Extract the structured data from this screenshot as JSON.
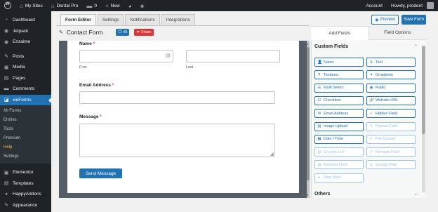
{
  "adminbar": {
    "my_sites": "My Sites",
    "site_name": "Dental Pro",
    "comments_count": "0",
    "new_label": "New",
    "account": "Account",
    "howdy": "Howdy, prodent"
  },
  "sidebar": {
    "items_top": [
      {
        "label": "Dashboard",
        "icon": "dashboard-icon",
        "glyph": "◔"
      },
      {
        "label": "Jetpack",
        "icon": "jetpack-icon",
        "glyph": "◉"
      },
      {
        "label": "Enzaime",
        "icon": "enzaime-icon",
        "glyph": "◉"
      }
    ],
    "items_mid": [
      {
        "label": "Posts",
        "icon": "pin-icon",
        "glyph": "✎"
      },
      {
        "label": "Media",
        "icon": "media-icon",
        "glyph": "▣"
      },
      {
        "label": "Pages",
        "icon": "pages-icon",
        "glyph": "▤"
      },
      {
        "label": "Comments",
        "icon": "comments-icon",
        "glyph": "▬"
      }
    ],
    "active": {
      "label": "weForms",
      "icon": "weforms-icon",
      "glyph": "◪"
    },
    "submenu": [
      "All Forms",
      "Entries",
      "Tools",
      "Premium",
      "Help",
      "Settings"
    ],
    "submenu_current": "Help",
    "items_bottom": [
      {
        "label": "Elementor",
        "icon": "elementor-icon",
        "glyph": "▣"
      },
      {
        "label": "Templates",
        "icon": "templates-icon",
        "glyph": "▤"
      },
      {
        "label": "HappyAddons",
        "icon": "happyaddons-icon",
        "glyph": "◕"
      },
      {
        "label": "Appearance",
        "icon": "appearance-icon",
        "glyph": "✎"
      }
    ]
  },
  "tabs": [
    "Form Editor",
    "Settings",
    "Notifications",
    "Integrations"
  ],
  "active_tab": "Form Editor",
  "actions": {
    "preview": "Preview",
    "save": "Save Form"
  },
  "form": {
    "title": "Contact Form",
    "id_badge": "#5",
    "share_badge": "Share",
    "name_label": "Name",
    "first_label": "First",
    "last_label": "Last",
    "email_label": "Email Address",
    "message_label": "Message",
    "required_mark": "*",
    "submit_label": "Send Message"
  },
  "panel": {
    "tabs": [
      "Add Fields",
      "Field Options"
    ],
    "active_tab": "Add Fields",
    "custom_fields_title": "Custom Fields",
    "others_title": "Others",
    "fields": [
      {
        "label": "Name",
        "icon": "user-icon",
        "glyph": "👤",
        "enabled": true
      },
      {
        "label": "Text",
        "icon": "text-icon",
        "glyph": "A",
        "enabled": true
      },
      {
        "label": "Textarea",
        "icon": "paragraph-icon",
        "glyph": "¶",
        "enabled": true
      },
      {
        "label": "Dropdown",
        "icon": "dropdown-icon",
        "glyph": "▾",
        "enabled": true
      },
      {
        "label": "Multi Select",
        "icon": "list-icon",
        "glyph": "☰",
        "enabled": true
      },
      {
        "label": "Radio",
        "icon": "radio-icon",
        "glyph": "◉",
        "enabled": true
      },
      {
        "label": "Checkbox",
        "icon": "checkbox-icon",
        "glyph": "☑",
        "enabled": true
      },
      {
        "label": "Website URL",
        "icon": "link-icon",
        "glyph": "🔗",
        "enabled": true
      },
      {
        "label": "Email Address",
        "icon": "envelope-icon",
        "glyph": "✉",
        "enabled": true
      },
      {
        "label": "Hidden Field",
        "icon": "eye-slash-icon",
        "glyph": "◐",
        "enabled": true
      },
      {
        "label": "Image Upload",
        "icon": "image-icon",
        "glyph": "▨",
        "enabled": true
      },
      {
        "label": "Repeat Field",
        "icon": "repeat-icon",
        "glyph": "↻",
        "enabled": false
      },
      {
        "label": "Date / Time",
        "icon": "calendar-icon",
        "glyph": "▦",
        "enabled": true
      },
      {
        "label": "File Upload",
        "icon": "upload-icon",
        "glyph": "⇪",
        "enabled": false
      },
      {
        "label": "Country List",
        "icon": "globe-icon",
        "glyph": "◍",
        "enabled": false
      },
      {
        "label": "Numeric Field",
        "icon": "hash-icon",
        "glyph": "#",
        "enabled": false
      },
      {
        "label": "Address Field",
        "icon": "address-icon",
        "glyph": "▤",
        "enabled": false
      },
      {
        "label": "Google Map",
        "icon": "map-marker-icon",
        "glyph": "◎",
        "enabled": false
      },
      {
        "label": "Step Start",
        "icon": "step-icon",
        "glyph": "▸",
        "enabled": false
      }
    ]
  },
  "colors": {
    "accent": "#2271b1",
    "danger": "#d63638",
    "sidebar_bg": "#1d2327",
    "canvas_bg": "#555d66"
  }
}
